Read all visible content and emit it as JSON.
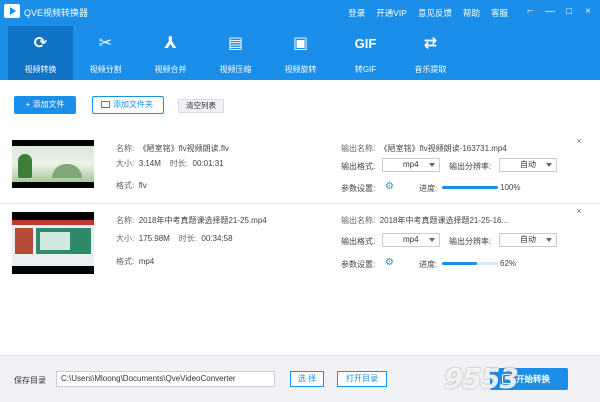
{
  "app": {
    "title": "QVE视频转换器"
  },
  "top_links": [
    "登录",
    "开通VIP",
    "意见反馈",
    "帮助",
    "客服"
  ],
  "window_controls": {
    "menu": "⌐",
    "minimize": "—",
    "maximize": "□",
    "close": "×"
  },
  "nav": [
    {
      "label": "视频转换",
      "icon": "convert-icon",
      "glyph": "⟳",
      "active": true
    },
    {
      "label": "视频分割",
      "icon": "scissors-icon",
      "glyph": "✂",
      "active": false
    },
    {
      "label": "视频合并",
      "icon": "merge-icon",
      "glyph": "⅄",
      "active": false
    },
    {
      "label": "视频压缩",
      "icon": "compress-icon",
      "glyph": "▤",
      "active": false
    },
    {
      "label": "视频旋转",
      "icon": "rotate-icon",
      "glyph": "▣",
      "active": false
    },
    {
      "label": "转GIF",
      "icon": "gif-icon",
      "glyph": "GIF",
      "active": false
    },
    {
      "label": "音乐提取",
      "icon": "shuffle-icon",
      "glyph": "⇄",
      "active": false
    }
  ],
  "toolbar": {
    "add_file": "+ 添加文件",
    "add_folder": "添加文件夹",
    "clear_list": "清空列表"
  },
  "labels": {
    "name": "名称:",
    "size": "大小:",
    "duration": "时长:",
    "format": "格式:",
    "output_name": "输出名称:",
    "output_format": "输出格式:",
    "output_resolution": "输出分辨率:",
    "params": "参数设置:",
    "progress": "进度:"
  },
  "files": [
    {
      "name": "《陋室铭》flv视频朗读.flv",
      "size": "3.14M",
      "duration": "00:01:31",
      "format": "flv",
      "output_name": "《陋室铭》flv视频朗读-163731.mp4",
      "output_format": "mp4",
      "output_resolution": "自动",
      "progress": 1.0,
      "progress_text": "100%"
    },
    {
      "name": "2018年中考真题课选择题21-25.mp4",
      "size": "175.98M",
      "duration": "00:34:58",
      "format": "mp4",
      "output_name": "2018年中考真题课选择题21-25-16...",
      "output_format": "mp4",
      "output_resolution": "自动",
      "progress": 0.62,
      "progress_text": "62%"
    }
  ],
  "bottom": {
    "save_dir_label": "保存目录",
    "save_dir_path": "C:\\Users\\Mloong\\Documents\\QveVideoConverter",
    "choose": "选 择",
    "open_dir": "打开目录",
    "start": "开始转换"
  },
  "watermark": "9553"
}
